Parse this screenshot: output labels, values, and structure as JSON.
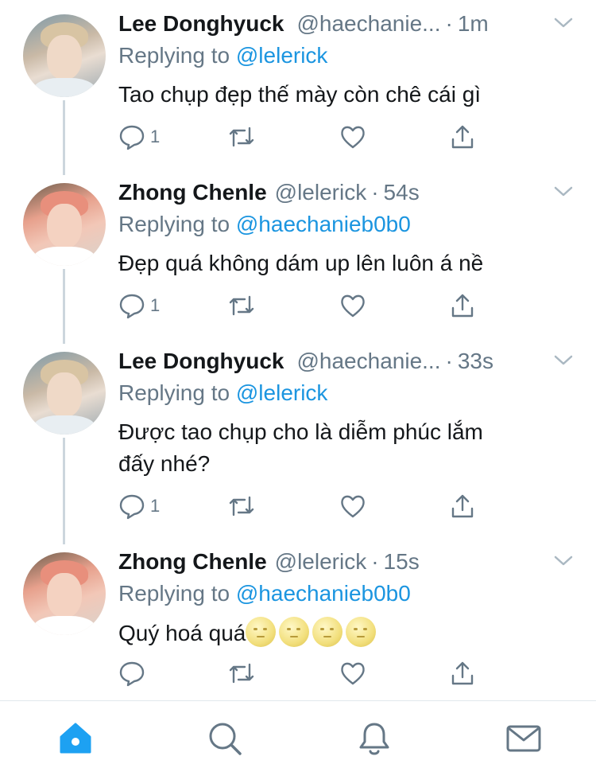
{
  "tweets": [
    {
      "name": "Lee Donghyuck",
      "handle": "@haechanie...",
      "dot": "·",
      "time": "1m",
      "replying_prefix": "Replying to ",
      "replying_to": "@lelerick",
      "text": "Tao chụp đẹp thế mày còn chê cái gì",
      "reply_count": "1",
      "avatar": "hyuck"
    },
    {
      "name": "Zhong Chenle",
      "handle": "@lelerick",
      "dot": "·",
      "time": "54s",
      "replying_prefix": "Replying to ",
      "replying_to": "@haechanieb0b0",
      "text": "Đẹp quá không dám up lên luôn á nề",
      "reply_count": "1",
      "avatar": "lele"
    },
    {
      "name": "Lee Donghyuck",
      "handle": "@haechanie...",
      "dot": "·",
      "time": "33s",
      "replying_prefix": "Replying to ",
      "replying_to": "@lelerick",
      "text_line1": "Được tao chụp cho là diễm phúc lắm",
      "text_line2": "đấy nhé?",
      "reply_count": "1",
      "avatar": "hyuck"
    },
    {
      "name": "Zhong Chenle",
      "handle": "@lelerick",
      "dot": "·",
      "time": "15s",
      "replying_prefix": "Replying to ",
      "replying_to": "@haechanieb0b0",
      "text": "Quý hoá quá",
      "emoji": [
        "full-moon-face-emoji",
        "full-moon-face-emoji",
        "full-moon-face-emoji",
        "full-moon-face-emoji"
      ],
      "reply_count": "",
      "avatar": "lele"
    }
  ],
  "icons": {
    "reply": "reply-icon",
    "retweet": "retweet-icon",
    "like": "heart-icon",
    "share": "share-icon",
    "more": "chevron-down-icon"
  },
  "tabbar": {
    "items": [
      "home-icon",
      "search-icon",
      "notifications-bell-icon",
      "messages-envelope-icon"
    ],
    "active": "home-icon"
  },
  "colors": {
    "accent": "#1da1f2",
    "mention": "#1b95e0",
    "muted": "#657786",
    "text": "#14171a",
    "thread_line": "#ccd6dd"
  }
}
